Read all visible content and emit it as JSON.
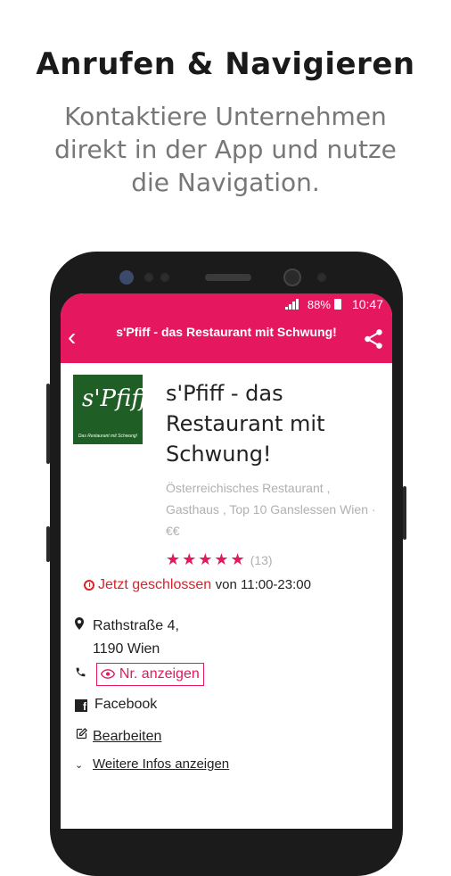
{
  "header": {
    "title": "Anrufen & Navigieren",
    "subtitle": "Kontaktiere Unternehmen direkt in der App und nutze die Navigation."
  },
  "status_bar": {
    "battery": "88%",
    "time": "10:47"
  },
  "app_bar": {
    "back_icon": "chevron-left-icon",
    "title": "s'Pfiff - das Restaurant mit Schwung!",
    "share_icon": "share-icon"
  },
  "business": {
    "logo_text": "s'Pfiff",
    "logo_tagline": "Das Restaurant mit Schwung!",
    "name": "s'Pfiff - das Restaurant mit Schwung!",
    "categories": "Österreichisches Restaurant , Gasthaus , Top 10 Ganslessen Wien · €€",
    "rating_stars": "★★★★★",
    "rating_count": "(13)",
    "rating_value": 5,
    "status_closed": "Jetzt geschlossen",
    "hours": "von 11:00-23:00"
  },
  "details": {
    "address_line1": "Rathstraße 4,",
    "address_line2": "1190 Wien",
    "show_number": "Nr. anzeigen",
    "facebook": "Facebook",
    "edit": "Bearbeiten",
    "more_info": "Weitere Infos anzeigen"
  },
  "colors": {
    "accent": "#e5175f",
    "closed": "#d8232a",
    "logo_bg": "#1f5e25"
  }
}
